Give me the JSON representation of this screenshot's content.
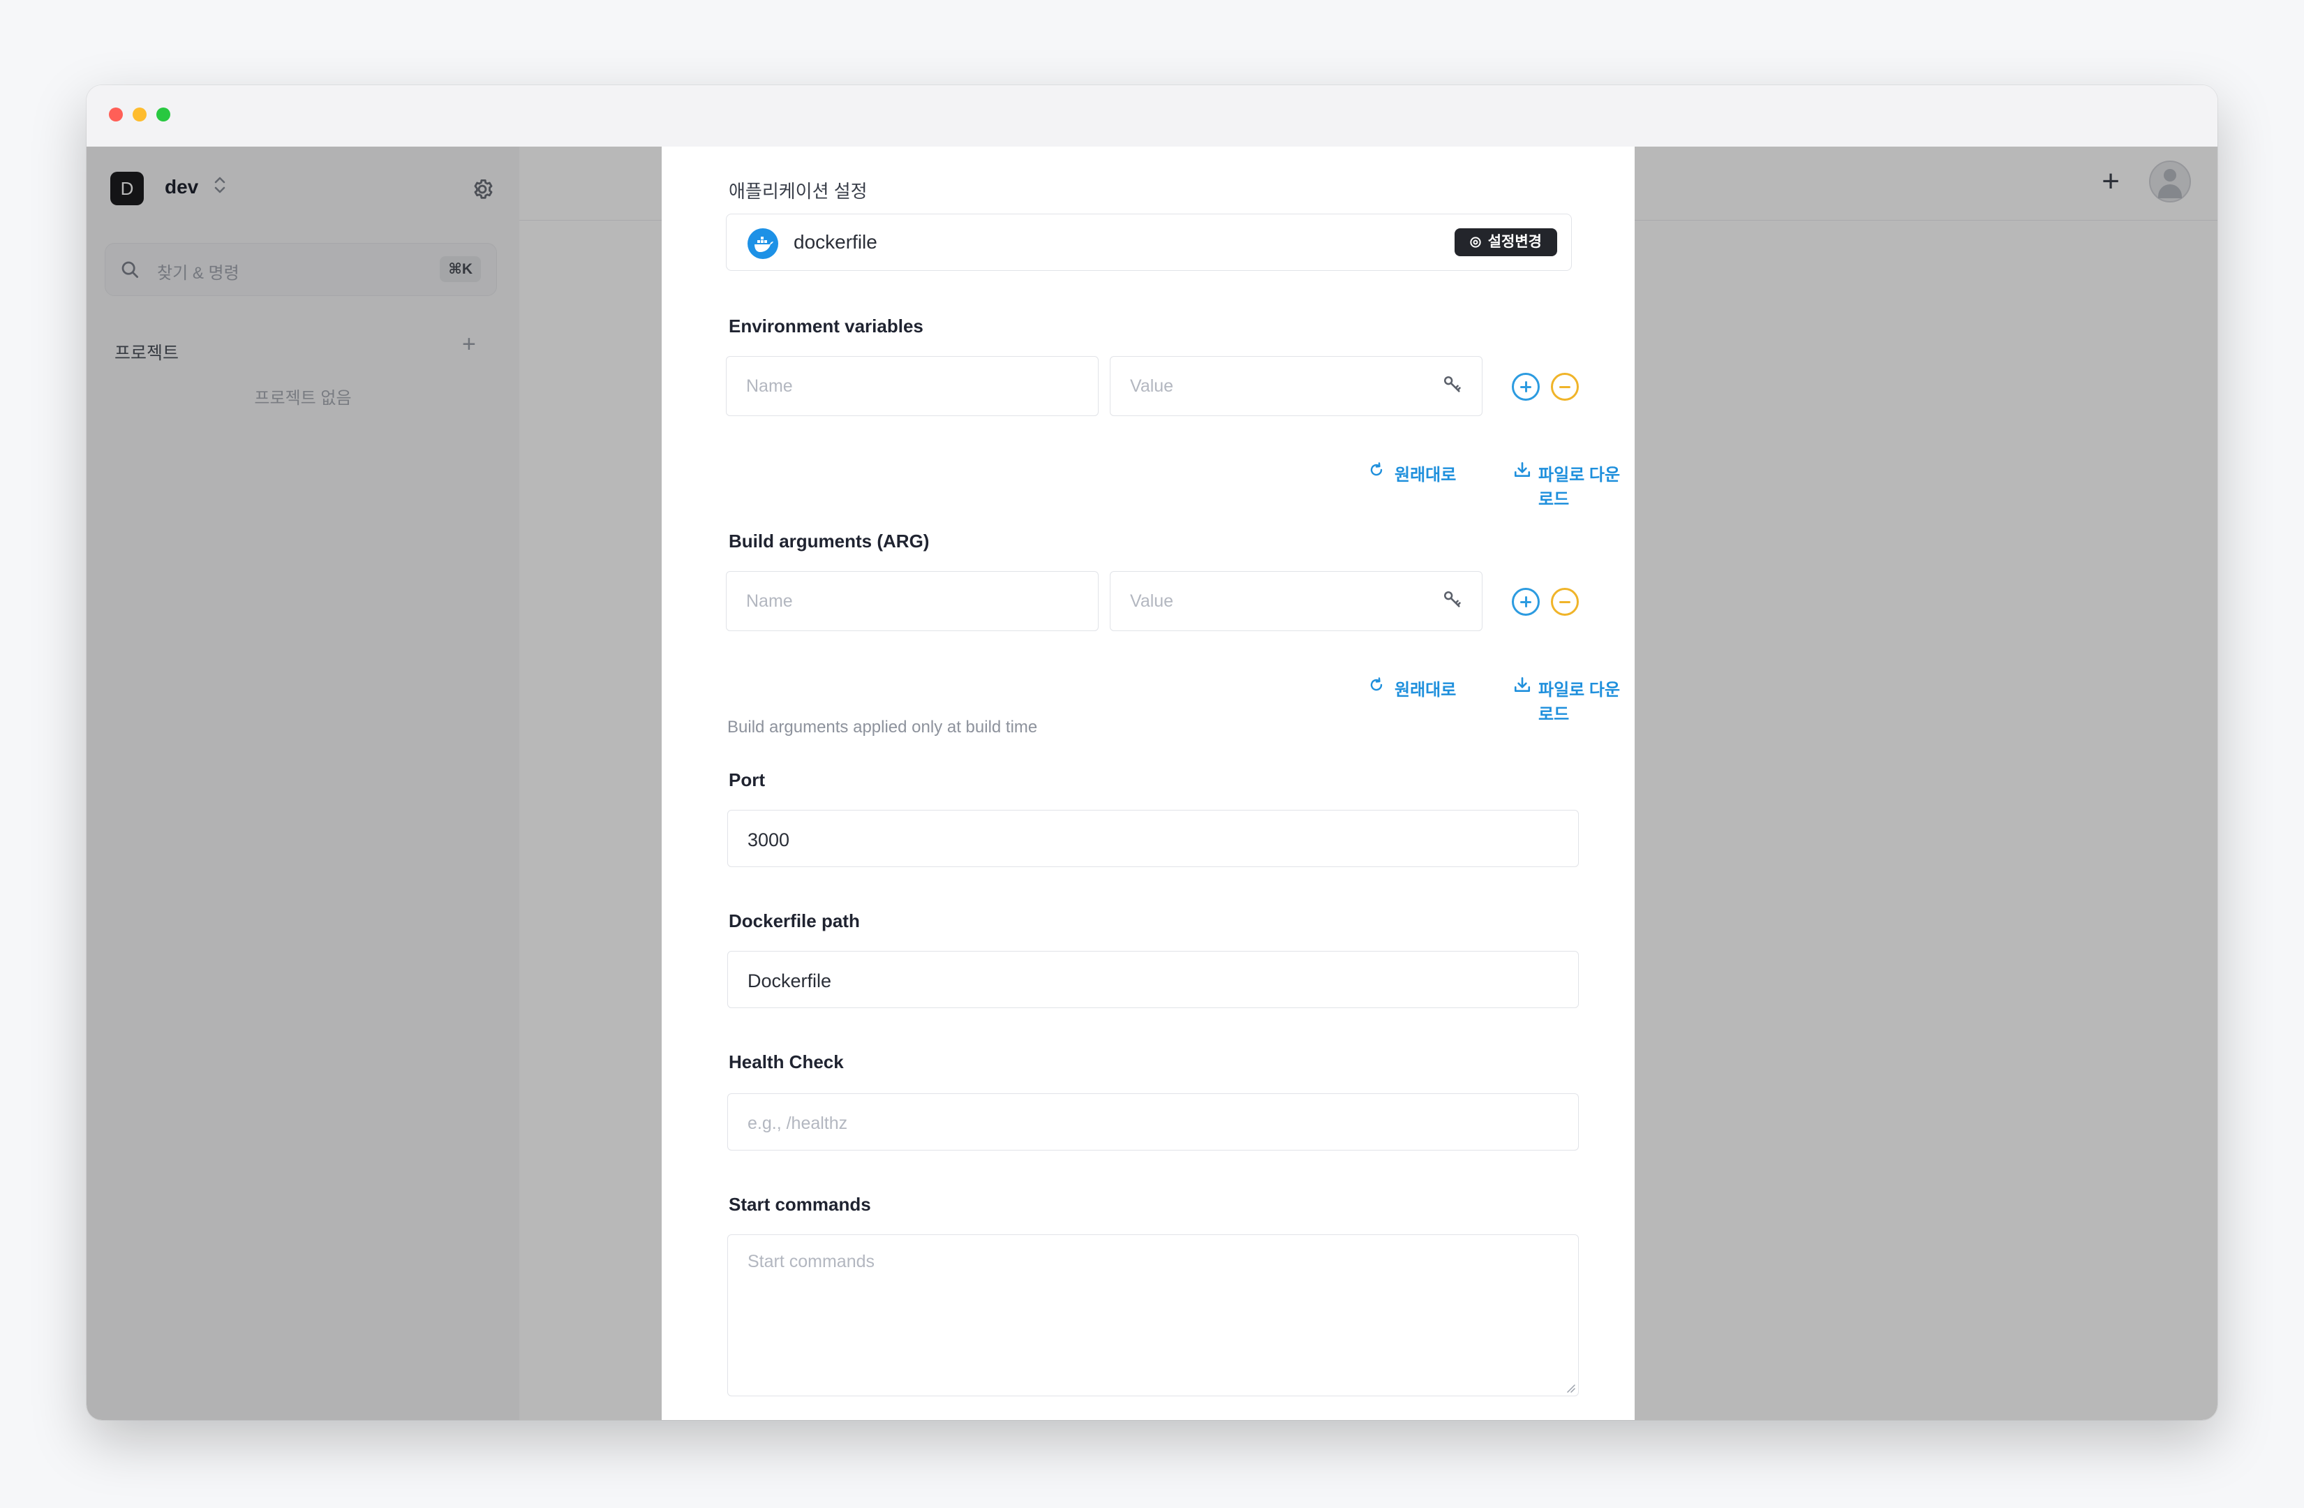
{
  "sidebar": {
    "workspace": {
      "initial": "D",
      "name": "dev",
      "switch_icon": "chevron-up-down-icon"
    },
    "search": {
      "placeholder": "찾기 & 명령",
      "shortcut": "⌘K"
    },
    "projects": {
      "heading": "프로젝트",
      "add": "+",
      "empty": "프로젝트 없음"
    }
  },
  "header": {
    "add": "+"
  },
  "modal": {
    "app_settings": {
      "heading": "애플리케이션 설정",
      "source": "dockerfile",
      "change_label": "설정변경"
    },
    "env": {
      "heading": "Environment variables",
      "name_placeholder": "Name",
      "value_placeholder": "Value",
      "reset": "원래대로",
      "download": "파일로 다운로드"
    },
    "build_args": {
      "heading": "Build arguments (ARG)",
      "name_placeholder": "Name",
      "value_placeholder": "Value",
      "reset": "원래대로",
      "download": "파일로 다운로드",
      "note": "Build arguments applied only at build time"
    },
    "port": {
      "label": "Port",
      "value": "3000"
    },
    "dockerfile_path": {
      "label": "Dockerfile path",
      "value": "Dockerfile"
    },
    "health_check": {
      "label": "Health Check",
      "placeholder": "e.g., /healthz"
    },
    "start_commands": {
      "label": "Start commands",
      "placeholder": "Start commands"
    }
  },
  "colors": {
    "accent": "#1e8fdc",
    "add": "#2c9be0",
    "remove": "#f0b429",
    "docker": "#1d91e6"
  }
}
